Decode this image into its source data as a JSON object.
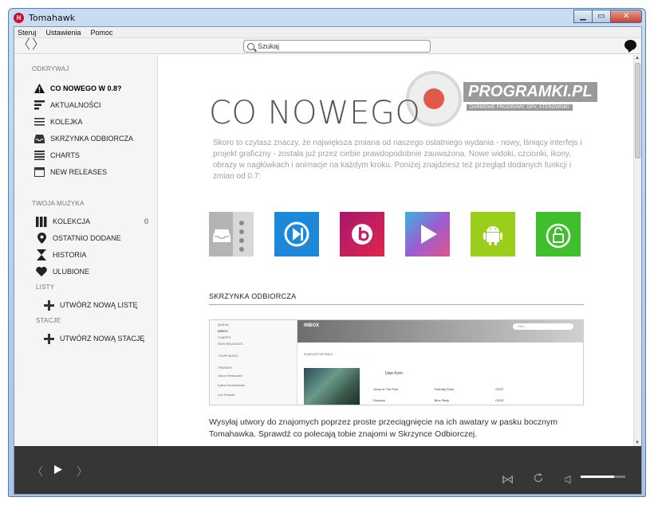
{
  "window": {
    "title": "Tomahawk",
    "app_icon_letter": "H"
  },
  "menu": [
    "Steruj",
    "Ustawienia",
    "Pomoc"
  ],
  "search": {
    "placeholder": "Szukaj"
  },
  "sidebar": {
    "discover_title": "ODKRYWAJ",
    "discover_items": [
      {
        "label": "CO NOWEGO W 0.8?",
        "icon": "warning-icon",
        "active": true
      },
      {
        "label": "AKTUALNOŚCI",
        "icon": "feed-icon"
      },
      {
        "label": "KOLEJKA",
        "icon": "queue-icon"
      },
      {
        "label": "SKRZYNKA ODBIORCZA",
        "icon": "inbox-icon"
      },
      {
        "label": "CHARTS",
        "icon": "charts-icon"
      },
      {
        "label": "NEW RELEASES",
        "icon": "new-releases-icon"
      }
    ],
    "music_title": "TWOJA MUZYKA",
    "music_items": [
      {
        "label": "KOLEKCJA",
        "icon": "collection-icon",
        "count": "0"
      },
      {
        "label": "OSTATNIO DODANE",
        "icon": "pin-icon"
      },
      {
        "label": "HISTORIA",
        "icon": "hourglass-icon"
      },
      {
        "label": "ULUBIONE",
        "icon": "heart-icon"
      }
    ],
    "lists_title": "LISTY",
    "new_list": "UTWÓRZ NOWĄ LISTĘ",
    "stations_title": "STACJE",
    "new_station": "UTWÓRZ NOWĄ STACJĘ"
  },
  "content": {
    "title": "CO NOWEGO",
    "intro": "Skoro to czytasz znaczy, że największa zmiana od naszego ostatniego wydania - nowy, lśniący interfejs i projekt graficzny - została już przez ciebie prawdopodobnie zauważona. Nowe widoki, czcionki, ikony, obrazy w nagłówkach i animacje na każdym kroku. Poniżej znajdziesz też przegląd dodanych funkcji i zmian od 0.7:",
    "tiles": [
      {
        "icon": "inbox-tile-icon",
        "color": "#b0b0b0"
      },
      {
        "icon": "skip-tile-icon",
        "color": "#1e88d8"
      },
      {
        "icon": "beats-tile-icon",
        "color": "#c51e64"
      },
      {
        "icon": "play-store-tile-icon",
        "color": "#4a9edb"
      },
      {
        "icon": "android-tile-icon",
        "color": "#9bcd1b"
      },
      {
        "icon": "unlock-tile-icon",
        "color": "#3fbf2c"
      }
    ],
    "section_heading": "SKRZYNKA ODBIORCZA",
    "body": "Wysyłaj utwory do znajomych poprzez proste przeciągnięcie na ich awatary w pasku bocznym Tomahawka. Sprawdź co polecają tobie znajomi w Skrzynce Odbiorczej."
  },
  "inbox_preview": {
    "sidebar_items": [
      "QUEUE",
      "INBOX",
      "CHARTS",
      "NEW RELEASES",
      "YOUR MUSIC",
      "FRIENDS",
      "Jason Herskowitz",
      "Kyiba Serafinowski",
      "Leo Franchi"
    ],
    "header_title": "INBOX",
    "filter_placeholder": "Filter...",
    "playlist_label": "PLAYLIST DETAILS",
    "sender": "Uwe Korn",
    "rows": [
      [
        "Jump In The Pool",
        "Friendly Fires",
        "03:37"
      ],
      [
        "Octopus",
        "Bloc Party",
        "03:20"
      ]
    ]
  },
  "watermark": {
    "brand": "PROGRAMKI.PL",
    "tagline": "DARMOWE PROGRAMY, GRY, STEROWNIKI"
  },
  "player": {
    "volume": 0.75
  }
}
